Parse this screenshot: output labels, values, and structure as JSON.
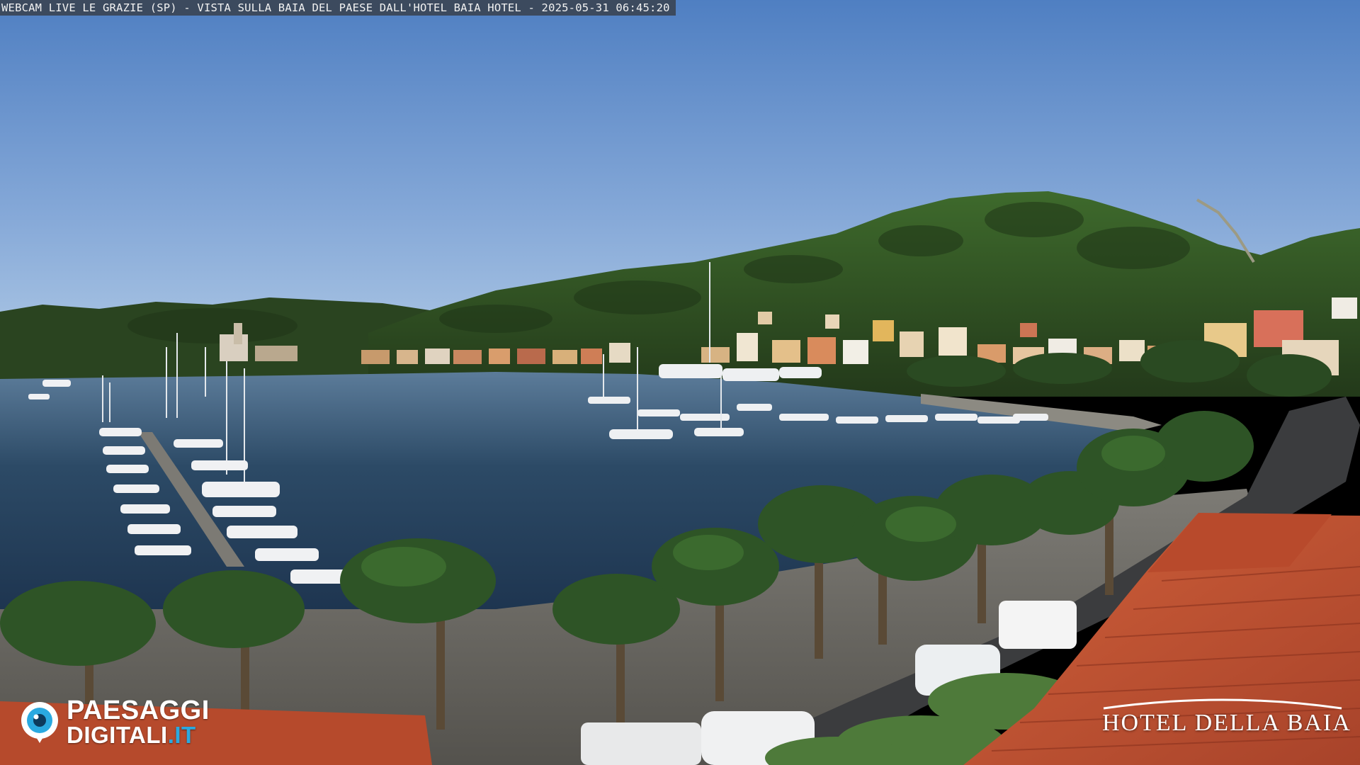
{
  "overlay": {
    "caption": "WEBCAM LIVE LE GRAZIE (SP) - VISTA SULLA BAIA DEL PAESE DALL'HOTEL BAIA HOTEL - 2025-05-31 06:45:20"
  },
  "watermark_left": {
    "line1": "PAESAGGI",
    "line2_main": "DIGITALI",
    "line2_suffix": ".IT",
    "logo_icon": "eye-camera-icon",
    "accent_color": "#2aa9e0"
  },
  "watermark_right": {
    "name": "HOTEL DELLA BAIA",
    "arc_icon": "hotel-arc-icon"
  },
  "scene": {
    "subject": "harbor-bay-webcam-view",
    "colors": {
      "sky_top": "#4f7fc2",
      "sky_bottom": "#a9c8e6",
      "hill": "#2f4f22",
      "water": "#2c4a66",
      "roof": "#c2502e",
      "promenade": "#6e6c66"
    }
  }
}
